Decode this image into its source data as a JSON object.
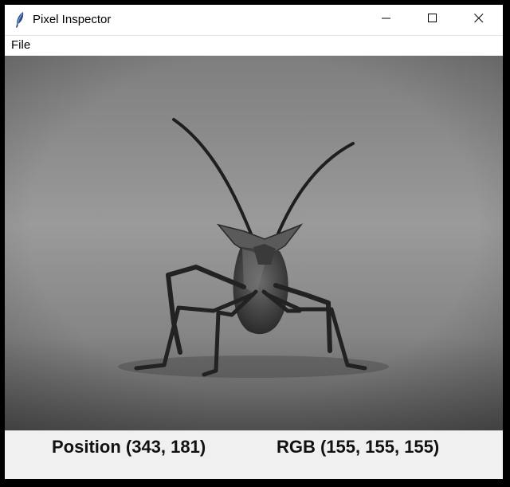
{
  "window": {
    "title": "Pixel Inspector",
    "controls": {
      "minimize": "minimize-icon",
      "maximize": "maximize-icon",
      "close": "close-icon"
    }
  },
  "menubar": {
    "items": [
      {
        "label": "File"
      }
    ]
  },
  "image": {
    "icon": "insect-photo",
    "colors": {
      "background": "#8f8f8f",
      "insect": "#2a2a2a"
    }
  },
  "status": {
    "position_text": "Position (343, 181)",
    "rgb_text": "RGB (155, 155, 155)"
  }
}
